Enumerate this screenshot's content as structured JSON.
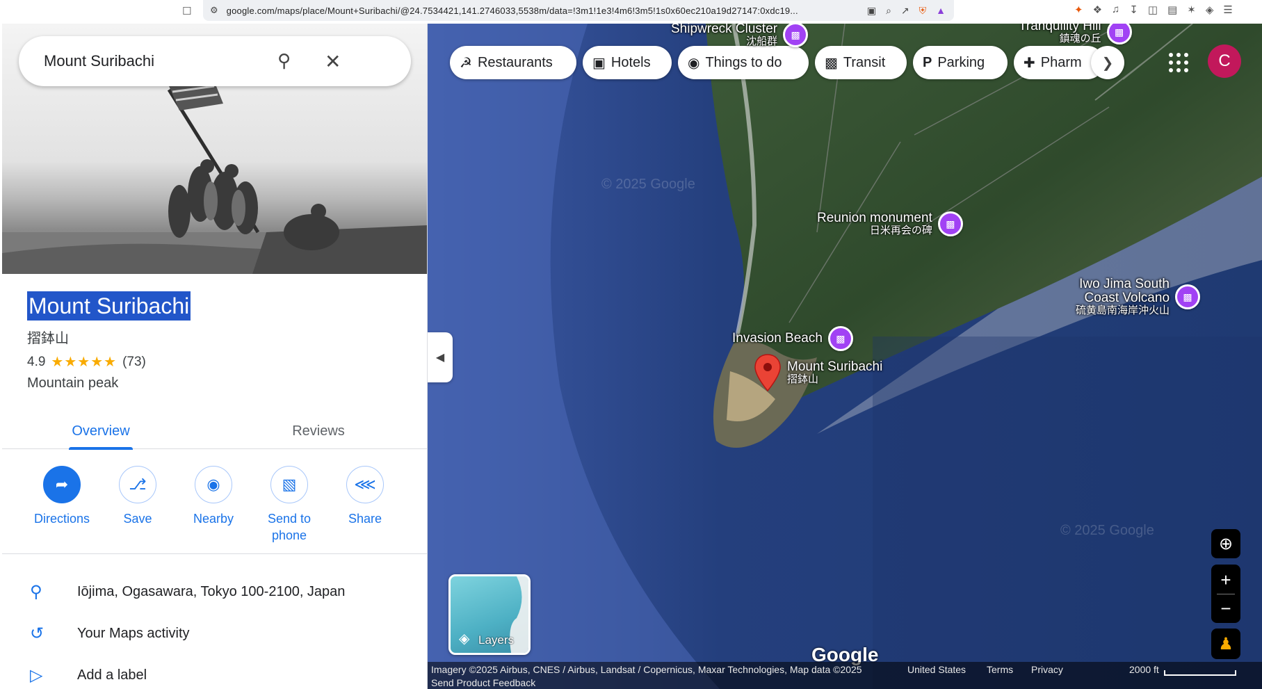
{
  "browser": {
    "url": "google.com/maps/place/Mount+Suribachi/@24.7534421,141.2746033,5538m/data=!3m1!1e3!4m6!3m5!1s0x60ec210a19d27147:0xdc19..."
  },
  "search": {
    "value": "Mount Suribachi"
  },
  "place": {
    "name": "Mount Suribachi",
    "native_name": "摺鉢山",
    "rating": "4.9",
    "stars": "★★★★★",
    "review_count": "(73)",
    "type": "Mountain peak"
  },
  "tabs": [
    "Overview",
    "Reviews"
  ],
  "actions": [
    {
      "label": "Directions"
    },
    {
      "label": "Save"
    },
    {
      "label": "Nearby"
    },
    {
      "label": "Send to phone"
    },
    {
      "label": "Share"
    }
  ],
  "info": {
    "address": "Iōjima, Ogasawara, Tokyo 100-2100, Japan",
    "activity": "Your Maps activity",
    "label": "Add a label"
  },
  "chips": [
    "Restaurants",
    "Hotels",
    "Things to do",
    "Transit",
    "Parking",
    "Pharm"
  ],
  "avatar_letter": "C",
  "pois": {
    "shipwreck": {
      "name": "Shipwreck Cluster",
      "native": "沈船群"
    },
    "tranquility": {
      "name": "Tranquility Hill",
      "native": "鎮魂の丘"
    },
    "reunion": {
      "name": "Reunion monument",
      "native": "日米再会の碑"
    },
    "volcano": {
      "name": "Iwo Jima South Coast Volcano",
      "name_line1": "Iwo Jima South",
      "name_line2": "Coast Volcano",
      "native": "硫黄島南海岸沖火山"
    },
    "beach": {
      "name": "Invasion Beach"
    },
    "suribachi": {
      "name": "Mount Suribachi",
      "native": "摺鉢山"
    }
  },
  "map": {
    "layers_label": "Layers",
    "logo": "Google",
    "watermark": "© 2025 Google",
    "imagery": "Imagery ©2025 Airbus, CNES / Airbus, Landsat / Copernicus, Maxar Technologies, Map data ©2025",
    "region": "United States",
    "terms": "Terms",
    "privacy": "Privacy",
    "feedback": "Send Product Feedback",
    "scale": "2000 ft"
  },
  "colors": {
    "accent": "#1a73e8",
    "poi": "#a142f4",
    "pin": "#ea4335",
    "avatar": "#c2185b",
    "ocean": "#233f7a"
  }
}
